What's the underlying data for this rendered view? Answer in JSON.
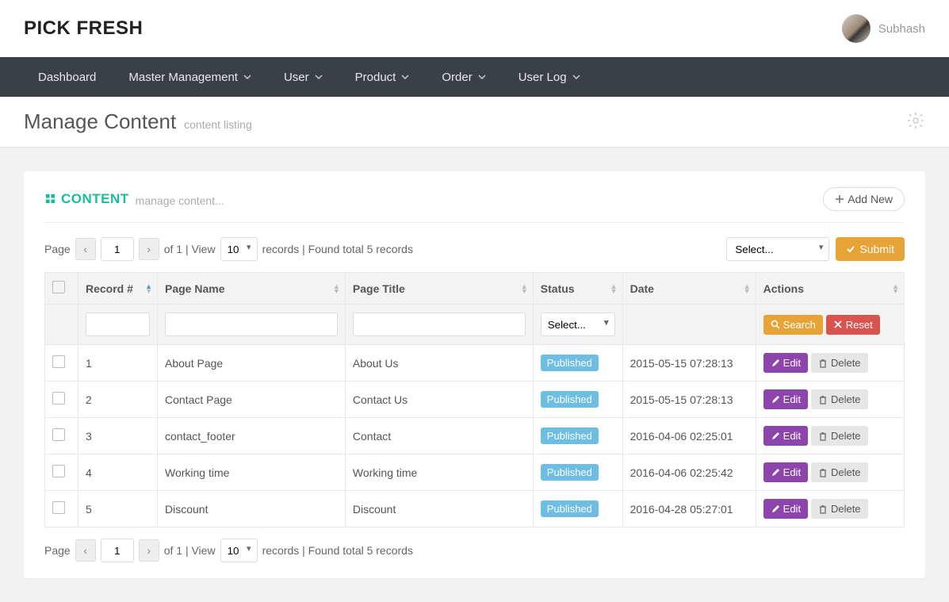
{
  "brand": "PICK FRESH",
  "user": {
    "name": "Subhash"
  },
  "nav": {
    "dashboard": "Dashboard",
    "master": "Master Management",
    "user": "User",
    "product": "Product",
    "order": "Order",
    "userlog": "User Log"
  },
  "page": {
    "title": "Manage Content",
    "subtitle": "content listing"
  },
  "panel": {
    "title": "CONTENT",
    "subtitle": "manage content...",
    "add_new": "Add New"
  },
  "pager": {
    "page_label": "Page",
    "current": "1",
    "of_text": "of 1 | View",
    "view": "10",
    "records_text": "records | Found total 5 records",
    "select_placeholder": "Select...",
    "submit": "Submit"
  },
  "table": {
    "headers": {
      "record": "Record #",
      "page_name": "Page Name",
      "page_title": "Page Title",
      "status": "Status",
      "date": "Date",
      "actions": "Actions"
    },
    "filter_select": "Select...",
    "search": "Search",
    "reset": "Reset",
    "edit": "Edit",
    "delete": "Delete",
    "rows": [
      {
        "rec": "1",
        "name": "About Page",
        "title": "About Us",
        "status": "Published",
        "date": "2015-05-15 07:28:13"
      },
      {
        "rec": "2",
        "name": "Contact Page",
        "title": "Contact Us",
        "status": "Published",
        "date": "2015-05-15 07:28:13"
      },
      {
        "rec": "3",
        "name": "contact_footer",
        "title": "Contact",
        "status": "Published",
        "date": "2016-04-06 02:25:01"
      },
      {
        "rec": "4",
        "name": "Working time",
        "title": "Working time",
        "status": "Published",
        "date": "2016-04-06 02:25:42"
      },
      {
        "rec": "5",
        "name": "Discount",
        "title": "Discount",
        "status": "Published",
        "date": "2016-04-28 05:27:01"
      }
    ]
  }
}
